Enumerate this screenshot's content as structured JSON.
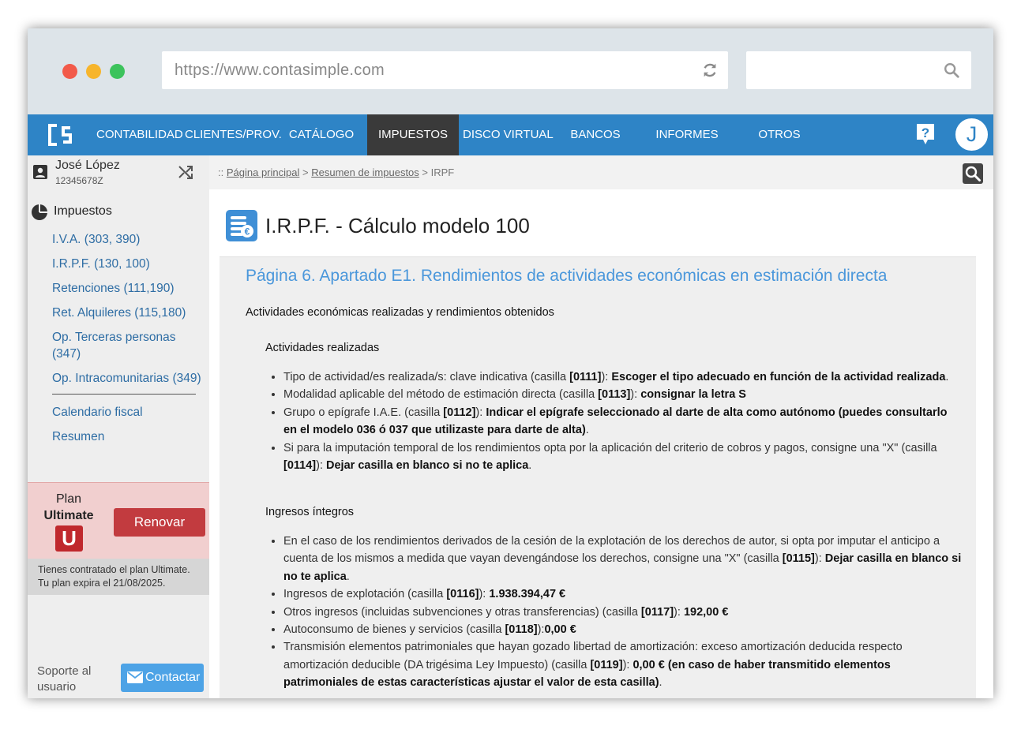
{
  "browser": {
    "url": "https://www.contasimple.com"
  },
  "nav": {
    "items": [
      "CONTABILIDAD",
      "CLIENTES/PROV.",
      "CATÁLOGO",
      "IMPUESTOS",
      "DISCO VIRTUAL",
      "BANCOS",
      "INFORMES",
      "OTROS"
    ],
    "active": "IMPUESTOS",
    "avatar_initial": "J",
    "brand_color": "#2e84c6"
  },
  "user": {
    "name": "José López",
    "nif": "12345678Z"
  },
  "sidebar": {
    "section_title": "Impuestos",
    "links": [
      "I.V.A. (303, 390)",
      "I.R.P.F. (130, 100)",
      "Retenciones (111,190)",
      "Ret. Alquileres (115,180)",
      "Op. Terceras personas (347)",
      "Op. Intracomunitarias (349)"
    ],
    "extra_links": [
      "Calendario fiscal",
      "Resumen"
    ],
    "plan": {
      "label": "Plan",
      "name": "Ultimate",
      "badge": "U",
      "renew_label": "Renovar",
      "info_line1": "Tienes contratado el plan Ultimate.",
      "info_line2": "Tu plan expira el 21/08/2025."
    },
    "support_text": "Soporte al usuario",
    "contact_label": "Contactar"
  },
  "breadcrumb": {
    "prefix": "::",
    "home": "Página principal",
    "summary": "Resumen de impuestos",
    "current": "IRPF",
    "sep": ">"
  },
  "main": {
    "title": "I.R.P.F. - Cálculo modelo 100",
    "heading": "Página 6. Apartado E1. Rendimientos de actividades económicas en estimación directa",
    "section1": "Actividades económicas realizadas y rendimientos obtenidos",
    "sub1": "Actividades realizadas",
    "sub2": "Ingresos íntegros"
  }
}
